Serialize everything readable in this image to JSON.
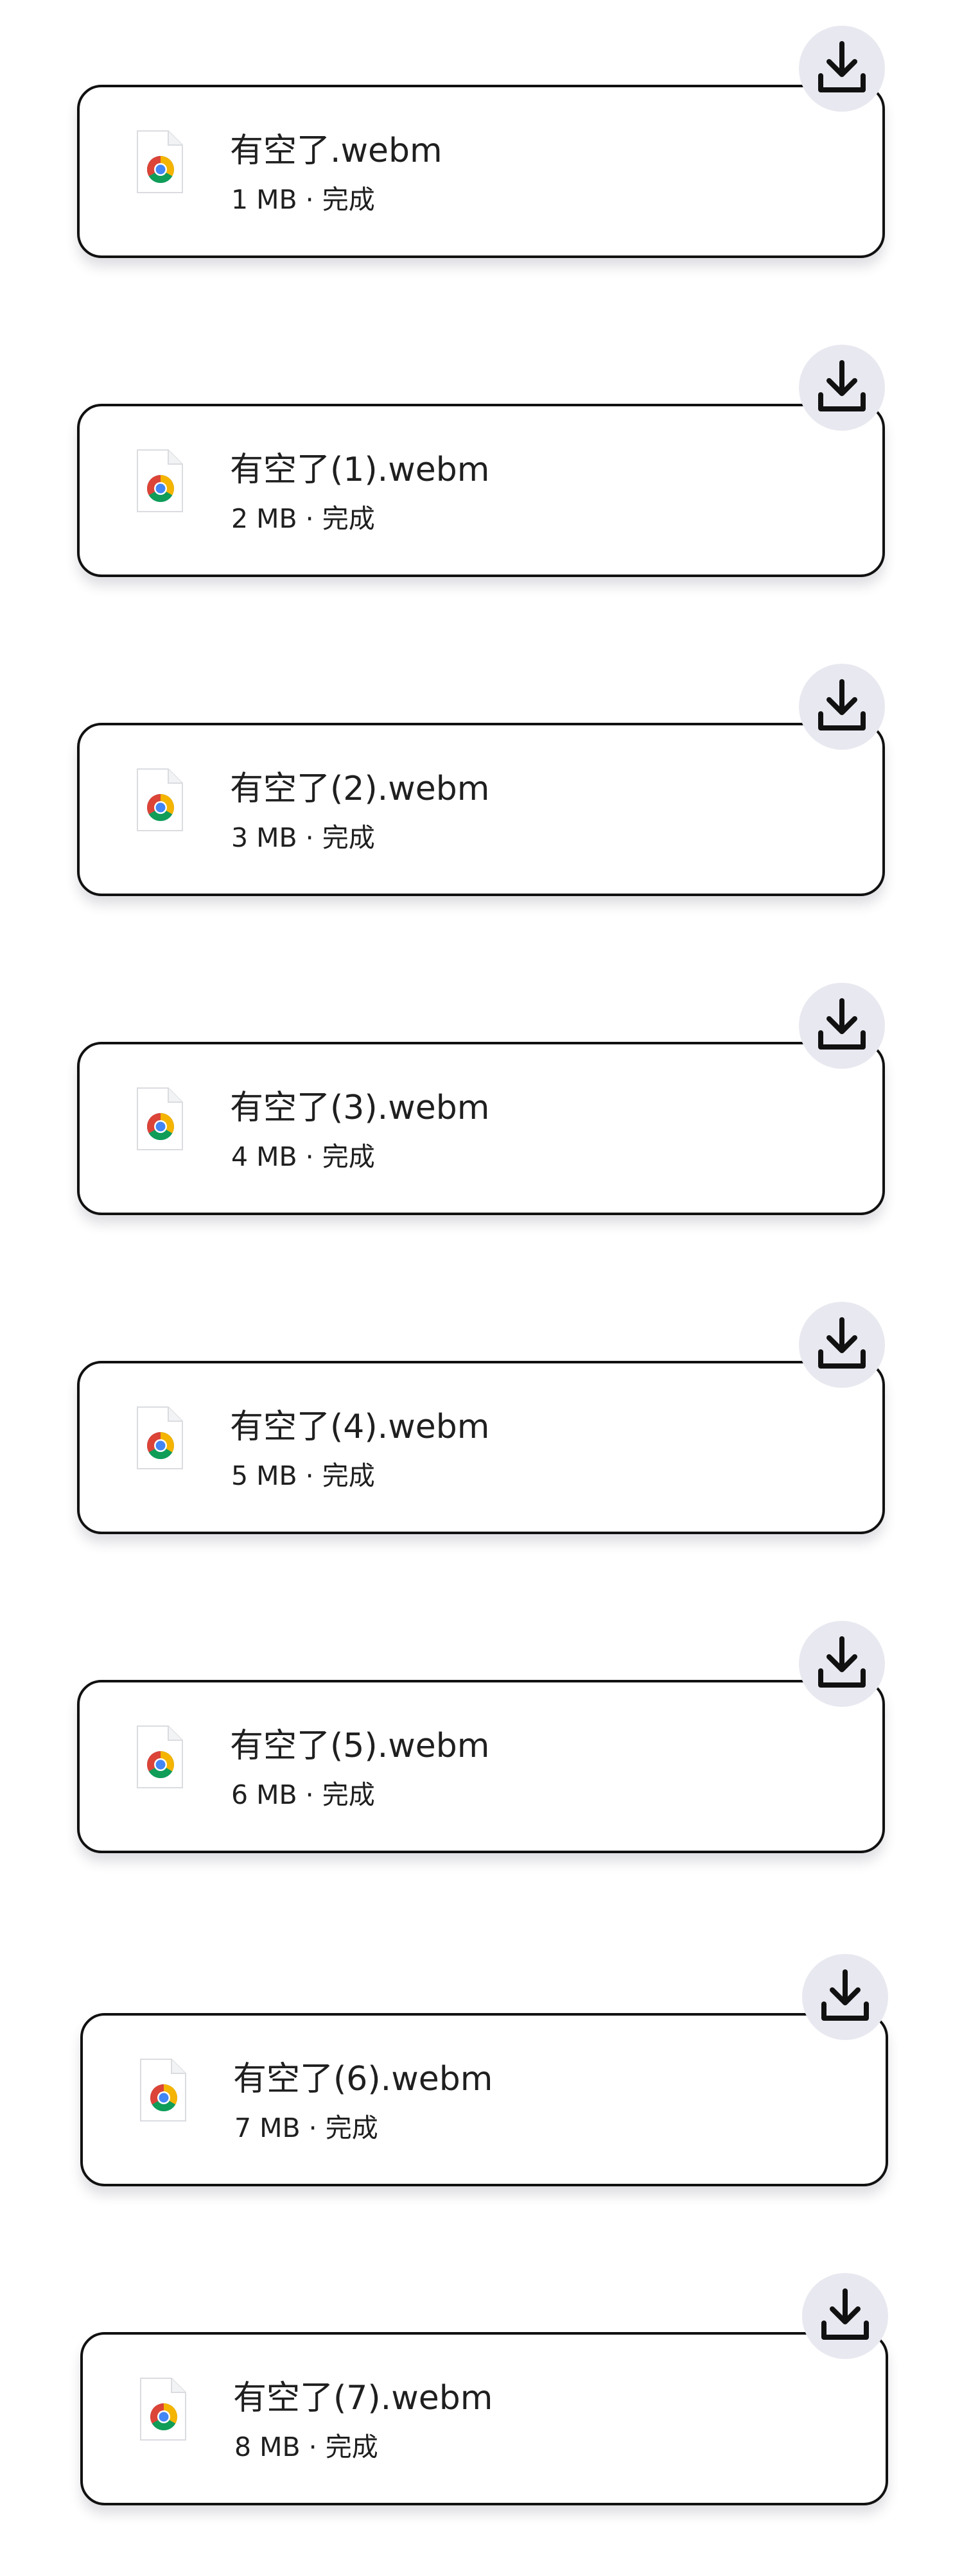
{
  "downloads": {
    "items": [
      {
        "file_name": "有空了.webm",
        "status": "1 MB · 完成",
        "icon": "chrome-file-icon",
        "action_icon": "download-icon"
      },
      {
        "file_name": "有空了(1).webm",
        "status": "2 MB · 完成",
        "icon": "chrome-file-icon",
        "action_icon": "download-icon"
      },
      {
        "file_name": "有空了(2).webm",
        "status": "3 MB · 完成",
        "icon": "chrome-file-icon",
        "action_icon": "download-icon"
      },
      {
        "file_name": "有空了(3).webm",
        "status": "4 MB · 完成",
        "icon": "chrome-file-icon",
        "action_icon": "download-icon"
      },
      {
        "file_name": "有空了(4).webm",
        "status": "5 MB · 完成",
        "icon": "chrome-file-icon",
        "action_icon": "download-icon"
      },
      {
        "file_name": "有空了(5).webm",
        "status": "6 MB · 完成",
        "icon": "chrome-file-icon",
        "action_icon": "download-icon"
      },
      {
        "file_name": "有空了(6).webm",
        "status": "7 MB · 完成",
        "icon": "chrome-file-icon",
        "action_icon": "download-icon"
      },
      {
        "file_name": "有空了(7).webm",
        "status": "8 MB · 完成",
        "icon": "chrome-file-icon",
        "action_icon": "download-icon"
      }
    ]
  },
  "colors": {
    "card_border": "#111111",
    "button_bg": "#e8e8f0",
    "text": "#1f1f1f",
    "chrome_red": "#db4437",
    "chrome_green": "#0f9d58",
    "chrome_yellow": "#f4b400",
    "chrome_blue": "#4285f4"
  }
}
